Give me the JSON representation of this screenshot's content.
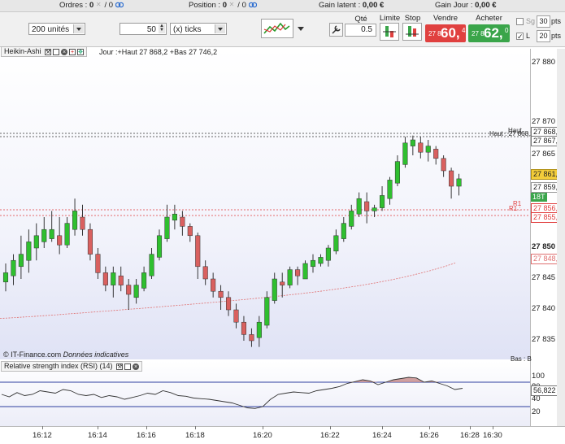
{
  "status": {
    "orders_label": "Ordres : ",
    "orders_value": "0",
    "orders_total": "/ 0",
    "position_label": "Position : ",
    "position_value": "0",
    "position_total": "/ 0",
    "gain_latent_label": "Gain latent : ",
    "gain_latent_value": "0,00 €",
    "gain_jour_label": "Gain Jour : ",
    "gain_jour_value": "0,00 €"
  },
  "toolbar": {
    "units_value": "200 unités",
    "ticks_value": "50",
    "ticks_unit": "(x) ticks",
    "qty_label": "Qté",
    "qty_value": "0.5",
    "limit_label": "Limite",
    "stop_label": "Stop",
    "sell_label": "Vendre",
    "buy_label": "Acheter",
    "sell_small": "27 8",
    "sell_big": "60,",
    "sell_sup": "4",
    "buy_small": "27 8",
    "buy_big": "62,",
    "buy_sup": "0",
    "sg_label": "Sg",
    "sg_value": "30",
    "sg_unit": "pts",
    "l_label": "L",
    "l_value": "20",
    "l_unit": "pts",
    "l_checked": "✓"
  },
  "chart": {
    "panel_title": "Heikin-Ashi",
    "info": "Jour :+Haut 27 868,2 +Bas 27 746,2",
    "copyright": "© IT-Finance.com",
    "indicative": "Données indicatives",
    "haut_label": "Haut",
    "haut_label2": "Haut : 27 868,2",
    "r1_label": "R1",
    "r1_label2": "R1 :",
    "bas_label": "Bas : B"
  },
  "price_axis": {
    "labels": [
      "27 880",
      "27 870",
      "27 865",
      "27 850",
      "27 845",
      "27 840",
      "27 835"
    ],
    "bold_label": "27 850",
    "tag_high": "27 868,2",
    "tag_high2": "27 867,8",
    "tag_last": "27 861,2",
    "tag_859": "27 859,8",
    "tag_timer": "18T",
    "tag_r1": "27 856,2",
    "tag_r1b": "27 855,5",
    "tag_ma": "27 848,3"
  },
  "rsi": {
    "title": "Relative strength index (RSI) (14)",
    "labels": [
      "100",
      "80",
      "60",
      "40",
      "20"
    ],
    "value_tag": "56,822"
  },
  "time_axis": {
    "labels": [
      "16:12",
      "16:14",
      "16:16",
      "16:18",
      "16:20",
      "16:22",
      "16:24",
      "16:26",
      "16:28",
      "16:30"
    ]
  },
  "colors": {
    "up": "#2fbf2f",
    "down": "#d9605f",
    "wick": "#222222",
    "ma": "#e07070",
    "r1": "#e03c3c",
    "rsi_line": "#333333",
    "rsi_band": "#2f3f9f",
    "rsi_fill": "#c98f8f"
  },
  "icons": [
    "wrench-icon",
    "window-icon",
    "close-icon",
    "add-icon",
    "move-icon",
    "indicator-chart-icon"
  ]
}
